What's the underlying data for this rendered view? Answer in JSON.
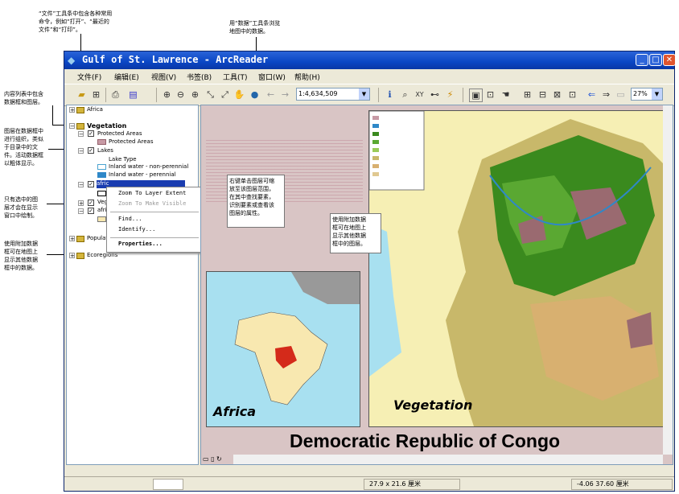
{
  "annotations": {
    "file_menu": [
      "“文件”工具条中包含各种常用",
      "命令，例如“打开”、“最近的",
      "文件”和“打印”。"
    ],
    "data_toolbar": [
      "用“数据”工具条浏览",
      "地图中的数据。"
    ],
    "toc_desc": [
      "内容列表中包含",
      "数据框和图层。"
    ],
    "layer_groups": [
      "图层在数据框中",
      "进行组织，类似",
      "于目录中的文",
      "件。活动数据框",
      "以粗体显示。"
    ],
    "checked_layers": [
      "只有选中的图",
      "层才会在显示",
      "窗口中绘制。"
    ],
    "extra_frames": [
      "使用附加数据",
      "框可在地图上",
      "显示其他数据",
      "框中的数据。"
    ],
    "right_click": [
      "右键单击图层可缩",
      "放至该图层范围，",
      "在其中查找要素，",
      "识别要素或查看该",
      "图层的属性。"
    ],
    "map_inset": [
      "使用附加数据",
      "框可在地图上",
      "显示其他数据",
      "框中的图层。"
    ]
  },
  "window": {
    "title": "Gulf of St. Lawrence - ArcReader",
    "menus": [
      "文件(F)",
      "编辑(E)",
      "视图(V)",
      "书签(B)",
      "工具(T)",
      "窗口(W)",
      "帮助(H)"
    ],
    "scale": "1:4,634,509",
    "zoom": "27%"
  },
  "toc": {
    "africa": "Africa",
    "vegetation": "Vegetation",
    "protected_areas": "Protected Areas",
    "protected_areas_legend": "Protected Areas",
    "lakes": "Lakes",
    "lake_type": "Lake Type",
    "inland_non_perennial": "Inland water - non-perennial",
    "inland_perennial": "Inland water - perennial",
    "africa_sel": "afric",
    "veg_short": "Veg",
    "afric_short": "afric",
    "population": "Populat",
    "ecoregions": "Ecoregions"
  },
  "context_menu": [
    "Zoom To Layer Extent",
    "Zoom To Make Visible",
    "Find...",
    "Identify...",
    "Properties..."
  ],
  "map": {
    "title": "Democratic Republic of Congo",
    "inset_africa": "Africa",
    "inset_vegetation": "Vegetation"
  },
  "status": {
    "page_size": "27.9 x 21.6 厘米",
    "coords": "-4.06  37.60 厘米"
  },
  "colors": {
    "titlebar": "#0a46c4",
    "ocean": "#a8e0f0",
    "forest": "#3a8a1e",
    "savanna": "#c8b86a",
    "highlight": "#1a3cb0"
  }
}
